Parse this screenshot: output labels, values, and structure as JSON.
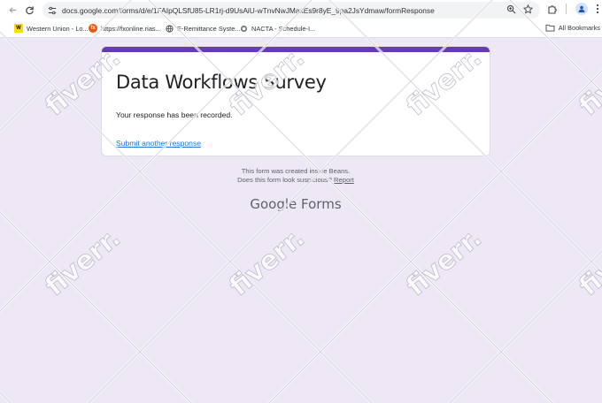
{
  "browser": {
    "url": "docs.google.com/forms/d/e/1FAIpQLSfU85-LR1rj-d9UsAiU-wTnvNwJMaxEs9r8yE_9pa2JsYdmaw/formResponse",
    "back_icon": "arrow-left-icon",
    "reload_icon": "reload-icon",
    "site_info_icon": "tune-icon",
    "zoom_icon": "zoom-icon",
    "bookmark_icon": "star-icon",
    "extensions_icon": "puzzle-icon",
    "profile_icon": "profile-icon",
    "menu_icon": "kebab-menu-icon"
  },
  "bookmarks": {
    "items": [
      {
        "label": "Western Union - Lo...",
        "icon": "western-union-icon"
      },
      {
        "label": "https://fxonline.rias...",
        "icon": "fx-icon"
      },
      {
        "label": "E-Remittance Syste...",
        "icon": "globe-icon"
      },
      {
        "label": "NACTA - Schedule-I...",
        "icon": "nacta-icon"
      }
    ],
    "all_label": "All Bookmarks",
    "all_icon": "folder-icon"
  },
  "form": {
    "title": "Data Workflows Survey",
    "message": "Your response has been recorded.",
    "submit_another": "Submit another response",
    "accent_color": "#673ab7"
  },
  "footer": {
    "line1": "This form was created inside Beans.",
    "line2_prefix": "Does this form look suspicious?",
    "report": "Report",
    "logo_google": "Google",
    "logo_forms": "Forms"
  },
  "watermark": {
    "text": "fiverr."
  }
}
